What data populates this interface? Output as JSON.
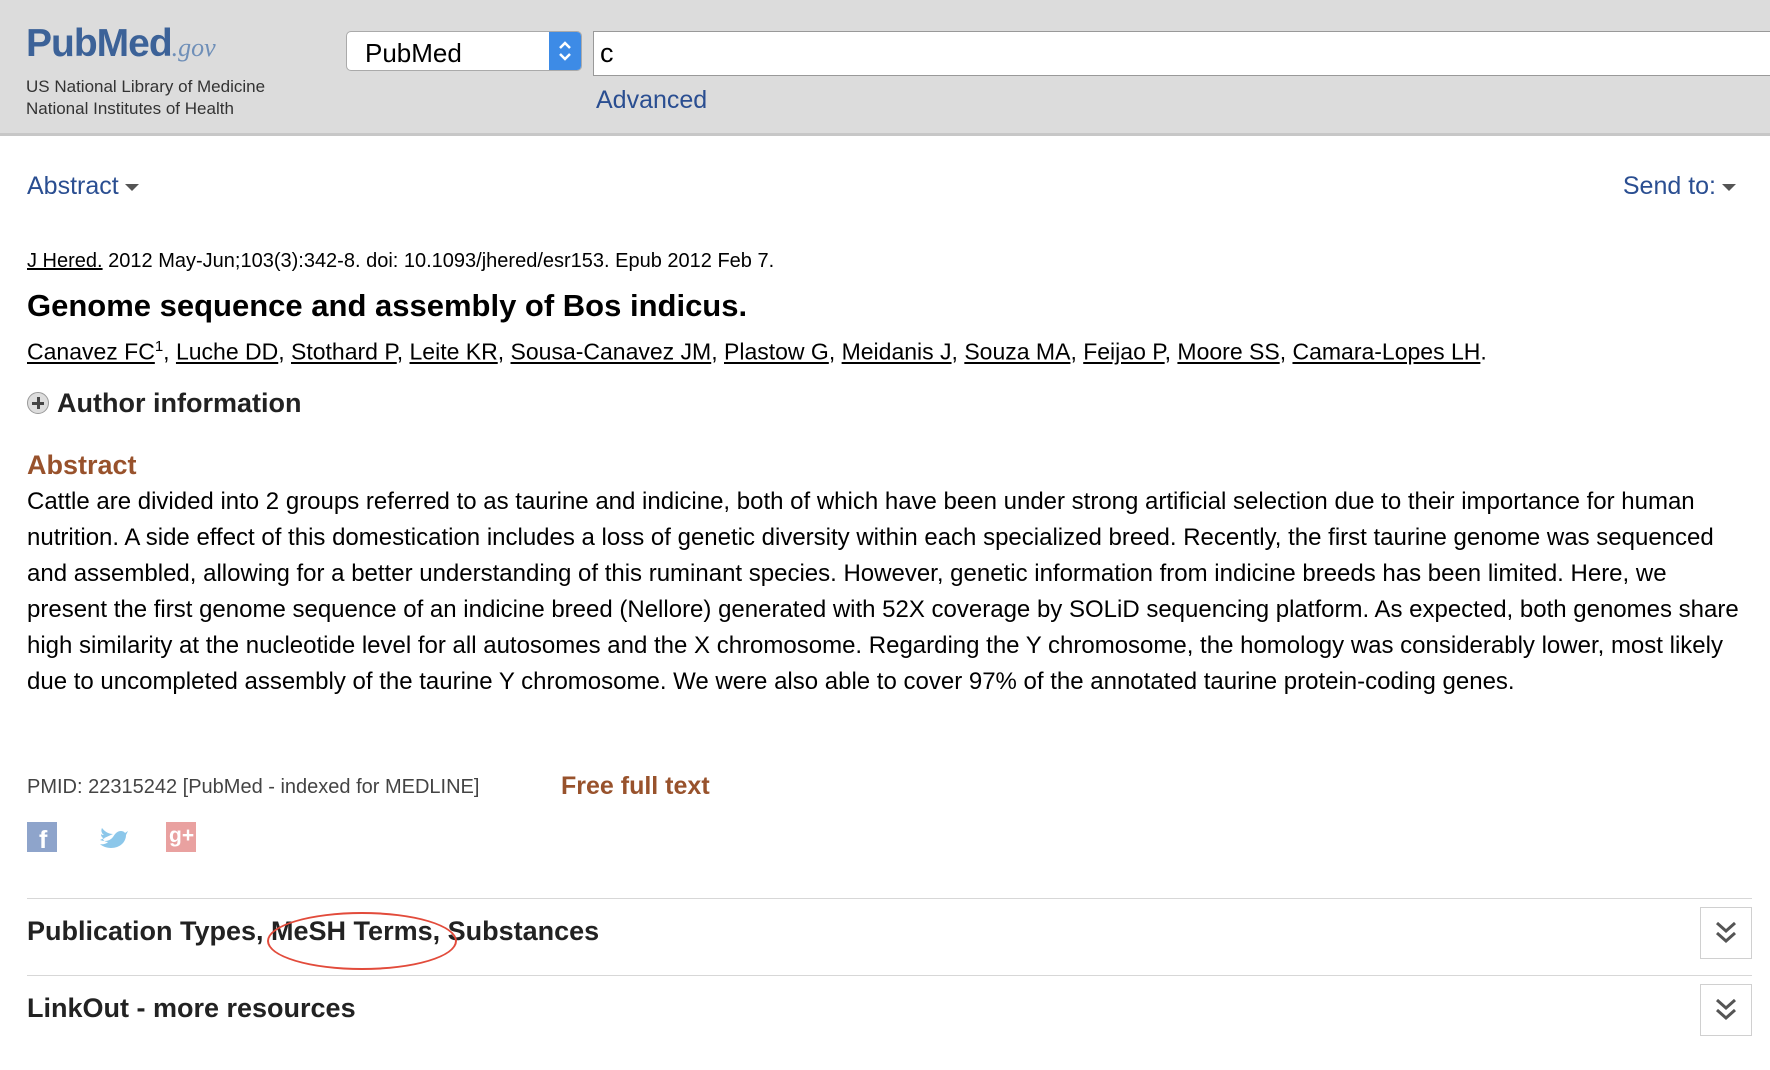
{
  "header": {
    "logo": {
      "pub": "Pub",
      "med": "Med",
      "gov": ".gov",
      "line1": "US National Library of Medicine",
      "line2": "National Institutes of Health"
    },
    "database_select": "PubMed",
    "search_value": "c",
    "advanced_label": "Advanced"
  },
  "toolbar": {
    "format_label": "Abstract",
    "send_to_label": "Send to:"
  },
  "article": {
    "journal": "J Hered.",
    "citation_rest": " 2012 May-Jun;103(3):342-8. doi: 10.1093/jhered/esr153. Epub 2012 Feb 7.",
    "title": "Genome sequence and assembly of Bos indicus.",
    "authors": [
      "Canavez FC",
      "Luche DD",
      "Stothard P",
      "Leite KR",
      "Sousa-Canavez JM",
      "Plastow G",
      "Meidanis J",
      "Souza MA",
      "Feijao P",
      "Moore SS",
      "Camara-Lopes LH"
    ],
    "first_author_sup": "1",
    "author_info_label": "Author information",
    "abstract_heading": "Abstract",
    "abstract_text": "Cattle are divided into 2 groups referred to as taurine and indicine, both of which have been under strong artificial selection due to their importance for human nutrition. A side effect of this domestication includes a loss of genetic diversity within each specialized breed. Recently, the first taurine genome was sequenced and assembled, allowing for a better understanding of this ruminant species. However, genetic information from indicine breeds has been limited. Here, we present the first genome sequence of an indicine breed (Nellore) generated with 52X coverage by SOLiD sequencing platform. As expected, both genomes share high similarity at the nucleotide level for all autosomes and the X chromosome. Regarding the Y chromosome, the homology was considerably lower, most likely due to uncompleted assembly of the taurine Y chromosome. We were also able to cover 97% of the annotated taurine protein-coding genes.",
    "pmid": "PMID: 22315242 [PubMed - indexed for MEDLINE]",
    "free_full_text": "Free full text"
  },
  "social": {
    "facebook_icon": "f",
    "googleplus_icon": "g+"
  },
  "sections": [
    {
      "title": "Publication Types, MeSH Terms, Substances"
    },
    {
      "title": "LinkOut - more resources"
    }
  ],
  "colors": {
    "link": "#2a4e91",
    "accent": "#98522c",
    "header_bg": "#dcdcdc",
    "annotation": "#e24b3b"
  }
}
